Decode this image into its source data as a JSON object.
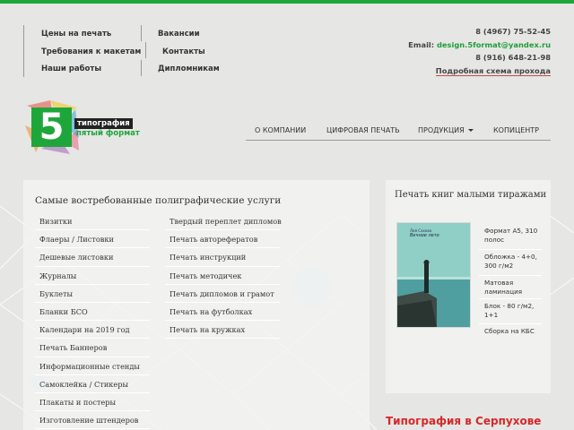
{
  "top_nav": {
    "col1": [
      "Цены на печать",
      "Требования к макетам",
      "Наши работы"
    ],
    "col2": [
      "Вакансии",
      "Контакты",
      "Дипломникам"
    ]
  },
  "contacts": {
    "phone1": "8 (4967) 75-52-45",
    "email_label": "Email:",
    "email": "design.5format@yandex.ru",
    "phone2": "8 (916) 648-21-98",
    "scheme_link": "Подробная схема прохода"
  },
  "logo": {
    "number": "5",
    "line1": "типография",
    "line2": "пятый формат"
  },
  "main_nav": {
    "items": [
      "О КОМПАНИИ",
      "ЦИФРОВАЯ ПЕЧАТЬ",
      "ПРОДУКЦИЯ",
      "КОПИЦЕНТР"
    ]
  },
  "services": {
    "title": "Самые востребованные полиграфические услуги",
    "col1": [
      "Визитки",
      "Флаеры / Листовки",
      "Дешевые листовки",
      "Журналы",
      "Буклеты",
      "Бланки БСО",
      "Календари на 2019 год",
      "Печать Баннеров",
      "Информационные стенды",
      "Самоклейка / Стикеры",
      "Плакаты и постеры",
      "Изготовление штендеров"
    ],
    "col2": [
      "Твердый переплет дипломов",
      "Печать авторефератов",
      "Печать инструкций",
      "Печать методичек",
      "Печать дипломов и грамот",
      "Печать на футболках",
      "Печать на кружках"
    ]
  },
  "books": {
    "title": "Печать книг малыми тиражами",
    "cover_author": "Лия Сахова",
    "cover_title": "Вечное лето",
    "specs": [
      "Формат А5, 310 полос",
      "Обложка - 4+0, 300 г/м2",
      "Матовая ламинация",
      "Блок - 80 г/м2, 1+1",
      "Сборка на КБС"
    ]
  },
  "city_title": "Типография в Серпухове",
  "colors": {
    "accent_green": "#1fa63a",
    "accent_red": "#d6282a",
    "background": "#e6e6e4"
  }
}
